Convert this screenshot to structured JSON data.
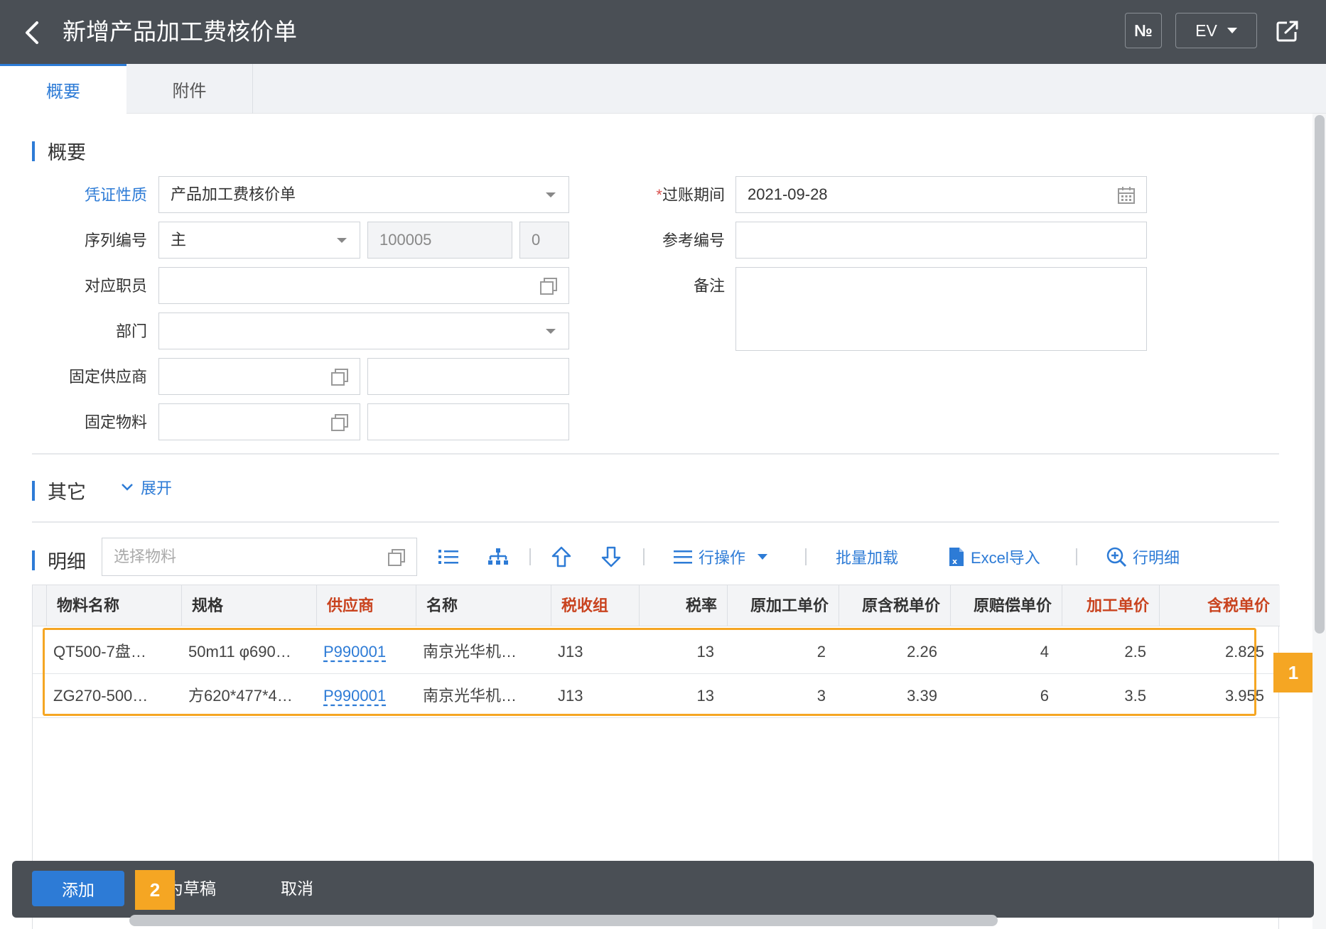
{
  "header": {
    "title": "新增产品加工费核价单",
    "no_label": "№",
    "lang_label": "EV"
  },
  "tabs": [
    {
      "label": "概要"
    },
    {
      "label": "附件"
    }
  ],
  "summary": {
    "title": "概要",
    "fields": {
      "voucher_type": {
        "label": "凭证性质",
        "value": "产品加工费核价单"
      },
      "serial": {
        "label": "序列编号",
        "value": "主",
        "number": "100005",
        "suffix": "0"
      },
      "employee": {
        "label": "对应职员",
        "value": ""
      },
      "department": {
        "label": "部门",
        "value": ""
      },
      "fixed_supplier": {
        "label": "固定供应商",
        "value": "",
        "name": ""
      },
      "fixed_material": {
        "label": "固定物料",
        "value": "",
        "name": ""
      },
      "posting_date": {
        "required_mark": "*",
        "label": "过账期间",
        "value": "2021-09-28"
      },
      "reference": {
        "label": "参考编号",
        "value": ""
      },
      "remark": {
        "label": "备注",
        "value": ""
      }
    }
  },
  "other": {
    "title": "其它",
    "expand_label": "展开"
  },
  "detail": {
    "title": "明细",
    "material_placeholder": "选择物料",
    "toolbar": {
      "row_ops": "行操作",
      "batch_load": "批量加载",
      "excel_import": "Excel导入",
      "row_detail": "行明细"
    },
    "columns": [
      "物料名称",
      "规格",
      "供应商",
      "名称",
      "税收组",
      "税率",
      "原加工单价",
      "原含税单价",
      "原赔偿单价",
      "加工单价",
      "含税单价"
    ],
    "rows": [
      [
        "QT500-7盘…",
        "50m11 φ690…",
        "P990001",
        "南京光华机…",
        "J13",
        "13",
        "2",
        "2.26",
        "4",
        "2.5",
        "2.825"
      ],
      [
        "ZG270-500…",
        "方620*477*4…",
        "P990001",
        "南京光华机…",
        "J13",
        "13",
        "3",
        "3.39",
        "6",
        "3.5",
        "3.955"
      ]
    ]
  },
  "annotations": {
    "badge1": "1",
    "badge2": "2"
  },
  "footer": {
    "add": "添加",
    "draft": "为草稿",
    "cancel": "取消"
  },
  "colors": {
    "header_bg": "#4a4f55",
    "accent": "#2d7bd6",
    "highlight": "#f5a623",
    "required_header": "#c9431f"
  }
}
